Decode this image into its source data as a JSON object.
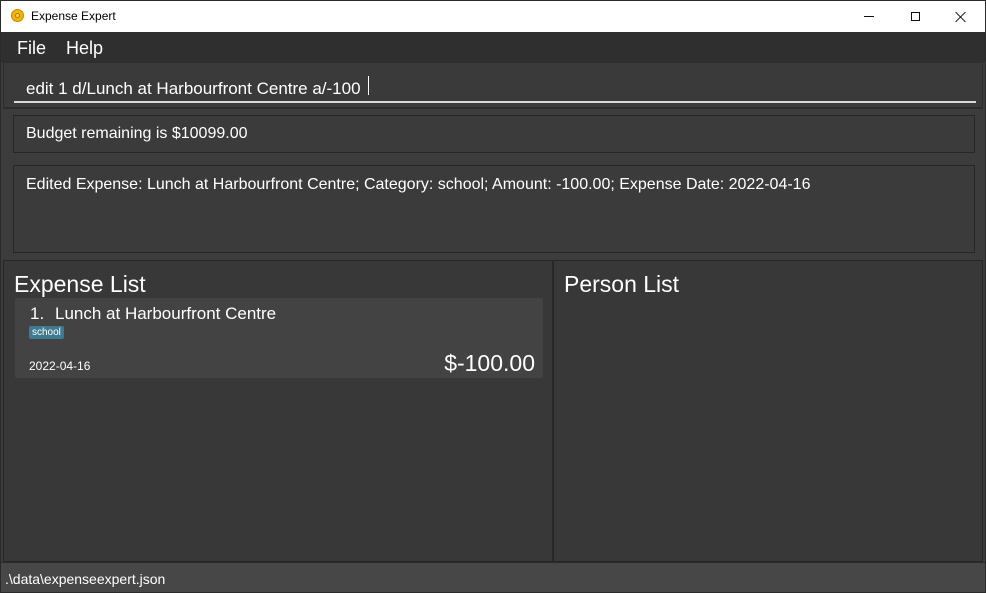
{
  "window": {
    "title": "Expense Expert"
  },
  "menu": {
    "file": "File",
    "help": "Help"
  },
  "command": {
    "value": "edit 1 d/Lunch at Harbourfront Centre a/-100"
  },
  "budget": {
    "text": "Budget remaining is $10099.00"
  },
  "result": {
    "text": "Edited Expense: Lunch at Harbourfront Centre; Category: school; Amount: -100.00; Expense Date: 2022-04-16"
  },
  "expense_list": {
    "title": "Expense List",
    "items": [
      {
        "index": "1.",
        "name": "Lunch at Harbourfront Centre",
        "tag": "school",
        "date": "2022-04-16",
        "amount": "$-100.00"
      }
    ]
  },
  "person_list": {
    "title": "Person List"
  },
  "status": {
    "file_path": ".\\data\\expenseexpert.json"
  },
  "colors": {
    "background": "#3c3c3c",
    "menubar": "#2f2f2f",
    "card": "#434343",
    "tag": "#3e7b91",
    "statusbar": "#474747"
  }
}
